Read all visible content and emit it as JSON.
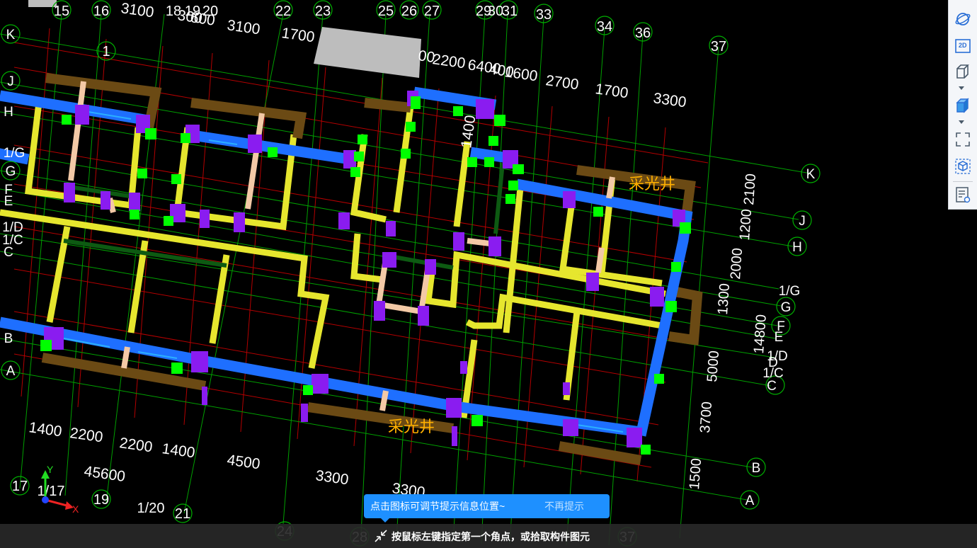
{
  "viewport": {
    "top_dims": [
      "3100",
      "3100",
      "1700",
      "2200",
      "400",
      "1600",
      "2700",
      "1700",
      "3300"
    ],
    "top_dims_stacked": [
      "300",
      "600"
    ],
    "misc_dims": {
      "d_1400": "1400",
      "d_600r": "00",
      "d_2200b": "2200",
      "d_6400": "6400"
    },
    "bottom_dims": [
      "1400",
      "2200",
      "2200",
      "1400",
      "4500",
      "3300",
      "3300"
    ],
    "bottom_total": "45600",
    "right_dims": [
      "2100",
      "1200",
      "2000",
      "1300",
      "14800",
      "5000",
      "3700",
      "1500"
    ],
    "top_axes": [
      "15",
      "16",
      "18",
      "19",
      "20",
      "22",
      "23",
      "25",
      "26",
      "27",
      "29",
      "30",
      "31",
      "33",
      "34",
      "36",
      "37"
    ],
    "bottom_axes": [
      "17",
      "1/17",
      "19",
      "1/20",
      "21",
      "24",
      "28",
      "37"
    ],
    "left_axes": [
      "K",
      "J",
      "H",
      "1/G",
      "G",
      "F",
      "E",
      "1/D",
      "1/C",
      "C",
      "B",
      "A"
    ],
    "right_axes": [
      "K",
      "J",
      "H",
      "1/G",
      "G",
      "F",
      "E",
      "1/D",
      "D",
      "1/C",
      "C",
      "B",
      "A"
    ],
    "grid_label_1": "1",
    "labels": {
      "skylight_1": "采光井",
      "skylight_2": "采光井"
    },
    "gizmo": {
      "x": "X",
      "y": "Y"
    }
  },
  "toolbar": {
    "items": [
      {
        "name": "orbit-icon"
      },
      {
        "name": "2d-view-button",
        "label": "2D"
      },
      {
        "name": "3d-view-button"
      },
      {
        "name": "3d-solid-view-button"
      },
      {
        "name": "fullscreen-button"
      },
      {
        "name": "component-view-button"
      },
      {
        "name": "properties-view-button"
      }
    ]
  },
  "tip": {
    "text": "点击图标可调节提示信息位置~",
    "dismiss": "不再提示"
  },
  "status": {
    "text": "按鼠标左键指定第一个角点，或拾取构件图元"
  },
  "colors": {
    "background": "#000000",
    "grid_line": "#00aa00",
    "red_grid": "#cc0000",
    "blue_beam": "#1e6fff",
    "yellow_wall": "#e8e83a",
    "brown_beam": "#6b4a14",
    "purple_column": "#8a1cf0",
    "green_marker": "#00ff00",
    "label_orange": "#ffb000",
    "tip_bg": "#1e90ff",
    "status_bg": "#282828"
  }
}
